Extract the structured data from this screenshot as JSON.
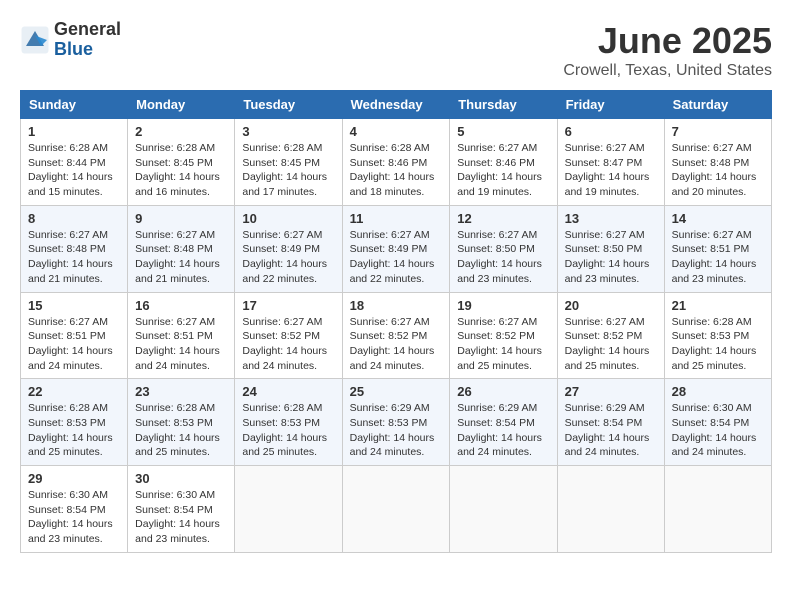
{
  "header": {
    "logo_general": "General",
    "logo_blue": "Blue",
    "month": "June 2025",
    "location": "Crowell, Texas, United States"
  },
  "calendar": {
    "days_of_week": [
      "Sunday",
      "Monday",
      "Tuesday",
      "Wednesday",
      "Thursday",
      "Friday",
      "Saturday"
    ],
    "weeks": [
      [
        {
          "day": "1",
          "sunrise": "6:28 AM",
          "sunset": "8:44 PM",
          "daylight": "14 hours and 15 minutes."
        },
        {
          "day": "2",
          "sunrise": "6:28 AM",
          "sunset": "8:45 PM",
          "daylight": "14 hours and 16 minutes."
        },
        {
          "day": "3",
          "sunrise": "6:28 AM",
          "sunset": "8:45 PM",
          "daylight": "14 hours and 17 minutes."
        },
        {
          "day": "4",
          "sunrise": "6:28 AM",
          "sunset": "8:46 PM",
          "daylight": "14 hours and 18 minutes."
        },
        {
          "day": "5",
          "sunrise": "6:27 AM",
          "sunset": "8:46 PM",
          "daylight": "14 hours and 19 minutes."
        },
        {
          "day": "6",
          "sunrise": "6:27 AM",
          "sunset": "8:47 PM",
          "daylight": "14 hours and 19 minutes."
        },
        {
          "day": "7",
          "sunrise": "6:27 AM",
          "sunset": "8:48 PM",
          "daylight": "14 hours and 20 minutes."
        }
      ],
      [
        {
          "day": "8",
          "sunrise": "6:27 AM",
          "sunset": "8:48 PM",
          "daylight": "14 hours and 21 minutes."
        },
        {
          "day": "9",
          "sunrise": "6:27 AM",
          "sunset": "8:48 PM",
          "daylight": "14 hours and 21 minutes."
        },
        {
          "day": "10",
          "sunrise": "6:27 AM",
          "sunset": "8:49 PM",
          "daylight": "14 hours and 22 minutes."
        },
        {
          "day": "11",
          "sunrise": "6:27 AM",
          "sunset": "8:49 PM",
          "daylight": "14 hours and 22 minutes."
        },
        {
          "day": "12",
          "sunrise": "6:27 AM",
          "sunset": "8:50 PM",
          "daylight": "14 hours and 23 minutes."
        },
        {
          "day": "13",
          "sunrise": "6:27 AM",
          "sunset": "8:50 PM",
          "daylight": "14 hours and 23 minutes."
        },
        {
          "day": "14",
          "sunrise": "6:27 AM",
          "sunset": "8:51 PM",
          "daylight": "14 hours and 23 minutes."
        }
      ],
      [
        {
          "day": "15",
          "sunrise": "6:27 AM",
          "sunset": "8:51 PM",
          "daylight": "14 hours and 24 minutes."
        },
        {
          "day": "16",
          "sunrise": "6:27 AM",
          "sunset": "8:51 PM",
          "daylight": "14 hours and 24 minutes."
        },
        {
          "day": "17",
          "sunrise": "6:27 AM",
          "sunset": "8:52 PM",
          "daylight": "14 hours and 24 minutes."
        },
        {
          "day": "18",
          "sunrise": "6:27 AM",
          "sunset": "8:52 PM",
          "daylight": "14 hours and 24 minutes."
        },
        {
          "day": "19",
          "sunrise": "6:27 AM",
          "sunset": "8:52 PM",
          "daylight": "14 hours and 25 minutes."
        },
        {
          "day": "20",
          "sunrise": "6:27 AM",
          "sunset": "8:52 PM",
          "daylight": "14 hours and 25 minutes."
        },
        {
          "day": "21",
          "sunrise": "6:28 AM",
          "sunset": "8:53 PM",
          "daylight": "14 hours and 25 minutes."
        }
      ],
      [
        {
          "day": "22",
          "sunrise": "6:28 AM",
          "sunset": "8:53 PM",
          "daylight": "14 hours and 25 minutes."
        },
        {
          "day": "23",
          "sunrise": "6:28 AM",
          "sunset": "8:53 PM",
          "daylight": "14 hours and 25 minutes."
        },
        {
          "day": "24",
          "sunrise": "6:28 AM",
          "sunset": "8:53 PM",
          "daylight": "14 hours and 25 minutes."
        },
        {
          "day": "25",
          "sunrise": "6:29 AM",
          "sunset": "8:53 PM",
          "daylight": "14 hours and 24 minutes."
        },
        {
          "day": "26",
          "sunrise": "6:29 AM",
          "sunset": "8:54 PM",
          "daylight": "14 hours and 24 minutes."
        },
        {
          "day": "27",
          "sunrise": "6:29 AM",
          "sunset": "8:54 PM",
          "daylight": "14 hours and 24 minutes."
        },
        {
          "day": "28",
          "sunrise": "6:30 AM",
          "sunset": "8:54 PM",
          "daylight": "14 hours and 24 minutes."
        }
      ],
      [
        {
          "day": "29",
          "sunrise": "6:30 AM",
          "sunset": "8:54 PM",
          "daylight": "14 hours and 23 minutes."
        },
        {
          "day": "30",
          "sunrise": "6:30 AM",
          "sunset": "8:54 PM",
          "daylight": "14 hours and 23 minutes."
        },
        null,
        null,
        null,
        null,
        null
      ]
    ]
  }
}
